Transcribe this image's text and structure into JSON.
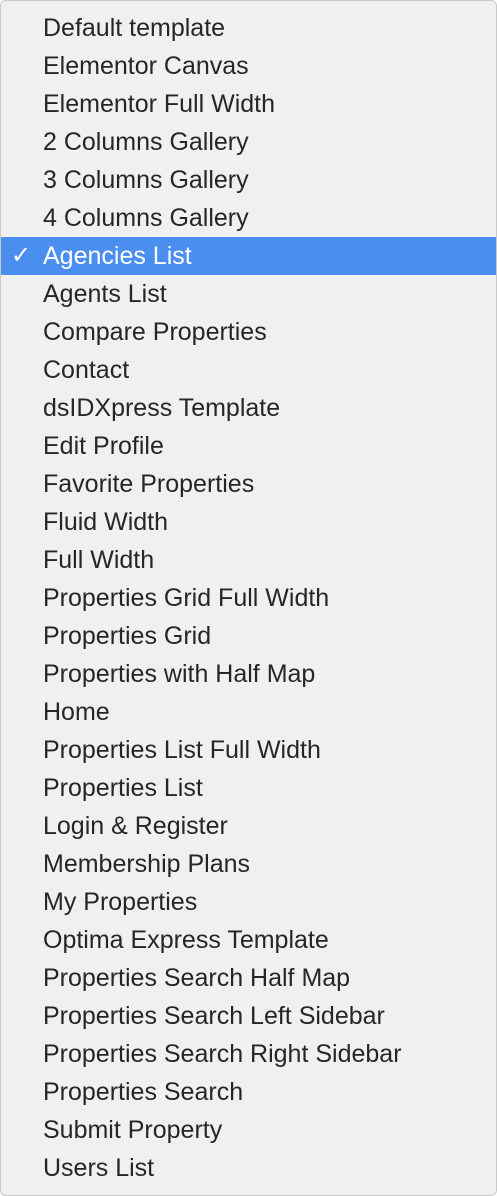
{
  "menu": {
    "selected_index": 6,
    "selected_color": "#4a8ff0",
    "checkmark_icon": "checkmark-icon",
    "items": [
      {
        "label": "Default template"
      },
      {
        "label": "Elementor Canvas"
      },
      {
        "label": "Elementor Full Width"
      },
      {
        "label": "2 Columns Gallery"
      },
      {
        "label": "3 Columns Gallery"
      },
      {
        "label": "4 Columns Gallery"
      },
      {
        "label": "Agencies List"
      },
      {
        "label": "Agents List"
      },
      {
        "label": "Compare Properties"
      },
      {
        "label": "Contact"
      },
      {
        "label": "dsIDXpress Template"
      },
      {
        "label": "Edit Profile"
      },
      {
        "label": "Favorite Properties"
      },
      {
        "label": "Fluid Width"
      },
      {
        "label": "Full Width"
      },
      {
        "label": "Properties Grid Full Width"
      },
      {
        "label": "Properties Grid"
      },
      {
        "label": "Properties with Half Map"
      },
      {
        "label": "Home"
      },
      {
        "label": "Properties List Full Width"
      },
      {
        "label": "Properties List"
      },
      {
        "label": "Login & Register"
      },
      {
        "label": "Membership Plans"
      },
      {
        "label": "My Properties"
      },
      {
        "label": "Optima Express Template"
      },
      {
        "label": "Properties Search Half Map"
      },
      {
        "label": "Properties Search Left Sidebar"
      },
      {
        "label": "Properties Search Right Sidebar"
      },
      {
        "label": "Properties Search"
      },
      {
        "label": "Submit Property"
      },
      {
        "label": "Users List"
      }
    ]
  }
}
